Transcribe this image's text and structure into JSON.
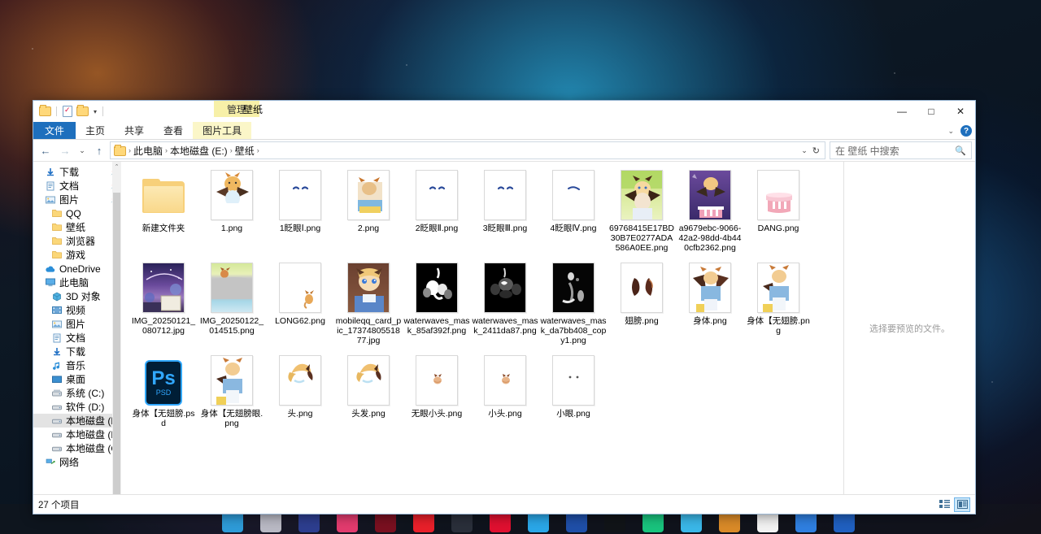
{
  "window": {
    "title": "壁纸",
    "contextual_tab_group": "管理",
    "controls": {
      "minimize": "—",
      "maximize": "□",
      "close": "✕"
    },
    "quick_access": {
      "folder_icon": "folder-icon",
      "properties_icon": "properties-icon",
      "new_folder_icon": "new-folder-icon",
      "dropdown": "▾"
    }
  },
  "ribbon": {
    "tabs": [
      {
        "label": "文件",
        "active": true
      },
      {
        "label": "主页",
        "active": false
      },
      {
        "label": "共享",
        "active": false
      },
      {
        "label": "查看",
        "active": false
      },
      {
        "label": "图片工具",
        "contextual": true
      }
    ],
    "collapse_chevron": "⌄",
    "help_label": "?"
  },
  "address": {
    "back": "←",
    "forward": "→",
    "recent": "⌄",
    "up": "↑",
    "folder_icon": "folder-icon",
    "breadcrumbs": [
      "此电脑",
      "本地磁盘 (E:)",
      "壁纸"
    ],
    "separator": "›",
    "dropdown": "⌄",
    "refresh": "↻"
  },
  "search": {
    "placeholder": "在 壁纸 中搜索",
    "icon": "search-icon"
  },
  "sidebar": {
    "items": [
      {
        "label": "下载",
        "icon": "download-icon",
        "indent": false,
        "pinned": true,
        "selected": false
      },
      {
        "label": "文档",
        "icon": "document-icon",
        "indent": false,
        "pinned": true,
        "selected": false
      },
      {
        "label": "图片",
        "icon": "pictures-icon",
        "indent": false,
        "pinned": true,
        "selected": false
      },
      {
        "label": "QQ",
        "icon": "folder-icon",
        "indent": true,
        "pinned": false,
        "selected": false
      },
      {
        "label": "壁纸",
        "icon": "folder-icon",
        "indent": true,
        "pinned": false,
        "selected": false
      },
      {
        "label": "浏览器",
        "icon": "folder-icon",
        "indent": true,
        "pinned": false,
        "selected": false
      },
      {
        "label": "游戏",
        "icon": "folder-icon",
        "indent": true,
        "pinned": false,
        "selected": false
      },
      {
        "label": "OneDrive",
        "icon": "onedrive-icon",
        "indent": false,
        "pinned": false,
        "selected": false
      },
      {
        "label": "此电脑",
        "icon": "this-pc-icon",
        "indent": false,
        "pinned": false,
        "selected": false
      },
      {
        "label": "3D 对象",
        "icon": "3d-objects-icon",
        "indent": true,
        "pinned": false,
        "selected": false
      },
      {
        "label": "视频",
        "icon": "videos-icon",
        "indent": true,
        "pinned": false,
        "selected": false
      },
      {
        "label": "图片",
        "icon": "pictures-icon",
        "indent": true,
        "pinned": false,
        "selected": false
      },
      {
        "label": "文档",
        "icon": "document-icon",
        "indent": true,
        "pinned": false,
        "selected": false
      },
      {
        "label": "下载",
        "icon": "download-icon",
        "indent": true,
        "pinned": false,
        "selected": false
      },
      {
        "label": "音乐",
        "icon": "music-icon",
        "indent": true,
        "pinned": false,
        "selected": false
      },
      {
        "label": "桌面",
        "icon": "desktop-icon",
        "indent": true,
        "pinned": false,
        "selected": false
      },
      {
        "label": "系统 (C:)",
        "icon": "system-drive-icon",
        "indent": true,
        "pinned": false,
        "selected": false
      },
      {
        "label": "软件 (D:)",
        "icon": "drive-icon",
        "indent": true,
        "pinned": false,
        "selected": false
      },
      {
        "label": "本地磁盘 (E:)",
        "icon": "drive-icon",
        "indent": true,
        "pinned": false,
        "selected": true
      },
      {
        "label": "本地磁盘 (F:)",
        "icon": "drive-icon",
        "indent": true,
        "pinned": false,
        "selected": false
      },
      {
        "label": "本地磁盘 (G:)",
        "icon": "drive-icon",
        "indent": true,
        "pinned": false,
        "selected": false
      },
      {
        "label": "网络",
        "icon": "network-icon",
        "indent": false,
        "pinned": false,
        "selected": false
      }
    ],
    "scroll_up": "⌃",
    "scroll_down": "⌄"
  },
  "files": [
    {
      "name": "新建文件夹",
      "kind": "folder"
    },
    {
      "name": "1.png",
      "kind": "image",
      "thumb": "char-wings"
    },
    {
      "name": "1眨眼Ⅰ.png",
      "kind": "image",
      "thumb": "eyes-small"
    },
    {
      "name": "2.png",
      "kind": "image",
      "thumb": "char-small"
    },
    {
      "name": "2眨眼Ⅱ.png",
      "kind": "image",
      "thumb": "eyes-small"
    },
    {
      "name": "3眨眼Ⅲ.png",
      "kind": "image",
      "thumb": "eyes-small"
    },
    {
      "name": "4眨眼Ⅳ.png",
      "kind": "image",
      "thumb": "eyes-single"
    },
    {
      "name": "69768415E17BD30B7E0277ADA586A0EE.png",
      "kind": "image",
      "thumb": "char-green"
    },
    {
      "name": "a9679ebc-9066-42a2-98dd-4b440cfb2362.png",
      "kind": "image",
      "thumb": "char-cake"
    },
    {
      "name": "DANG.png",
      "kind": "image",
      "thumb": "cake-pink"
    },
    {
      "name": "IMG_20250121_080712.jpg",
      "kind": "image",
      "thumb": "night-scene"
    },
    {
      "name": "IMG_20250122_014515.png",
      "kind": "image",
      "thumb": "day-scene"
    },
    {
      "name": "LONG62.png",
      "kind": "image",
      "thumb": "tiny-critter"
    },
    {
      "name": "mobileqq_card_pic_1737480551877.jpg",
      "kind": "image",
      "thumb": "char-card"
    },
    {
      "name": "waterwaves_mask_85af392f.png",
      "kind": "image",
      "thumb": "mask-white"
    },
    {
      "name": "waterwaves_mask_2411da87.png",
      "kind": "image",
      "thumb": "mask-grey"
    },
    {
      "name": "waterwaves_mask_da7bb408_copy1.png",
      "kind": "image",
      "thumb": "mask-dark"
    },
    {
      "name": "翅膀.png",
      "kind": "image",
      "thumb": "wings"
    },
    {
      "name": "身体.png",
      "kind": "image",
      "thumb": "body"
    },
    {
      "name": "身体【无翅膀.png",
      "kind": "image",
      "thumb": "body-nowings"
    },
    {
      "name": "身体【无翅膀.psd",
      "kind": "psd",
      "thumb": "psd"
    },
    {
      "name": "身体【无翅膀眼.png",
      "kind": "image",
      "thumb": "body-nowings"
    },
    {
      "name": "头.png",
      "kind": "image",
      "thumb": "head"
    },
    {
      "name": "头发.png",
      "kind": "image",
      "thumb": "head"
    },
    {
      "name": "无眼小头.png",
      "kind": "image",
      "thumb": "tiny-head"
    },
    {
      "name": "小头.png",
      "kind": "image",
      "thumb": "tiny-head"
    },
    {
      "name": "小眼.png",
      "kind": "image",
      "thumb": "eyes-dots"
    }
  ],
  "preview": {
    "empty_text": "选择要预览的文件。"
  },
  "status": {
    "item_count": "27 个项目",
    "view_details_icon": "details-view-icon",
    "view_large_icon": "large-icons-view-icon"
  },
  "taskbar": {
    "icons": [
      {
        "name": "windows-start-icon",
        "color": "#2e9bd8"
      },
      {
        "name": "app-icon-1",
        "color": "#b9b9c4"
      },
      {
        "name": "app-icon-2",
        "color": "#2d3e8f"
      },
      {
        "name": "app-icon-3",
        "color": "#e23b6e"
      },
      {
        "name": "app-icon-4",
        "color": "#7a1020"
      },
      {
        "name": "app-icon-5",
        "color": "#e8202a"
      },
      {
        "name": "app-icon-6",
        "color": "#2a2f3a"
      },
      {
        "name": "app-icon-7",
        "color": "#e01030"
      },
      {
        "name": "app-icon-8",
        "color": "#2aa7e8"
      },
      {
        "name": "app-icon-9",
        "color": "#1f4fa8"
      },
      {
        "name": "app-icon-10",
        "color": "#111418"
      },
      {
        "name": "app-icon-11",
        "color": "#19c37d"
      },
      {
        "name": "app-icon-12",
        "color": "#3ab7e8"
      },
      {
        "name": "app-icon-13",
        "color": "#d98a28"
      },
      {
        "name": "app-icon-14",
        "color": "#f2f2f2"
      },
      {
        "name": "app-icon-15",
        "color": "#2f7fe0"
      },
      {
        "name": "app-icon-16",
        "color": "#2060c0"
      }
    ]
  }
}
